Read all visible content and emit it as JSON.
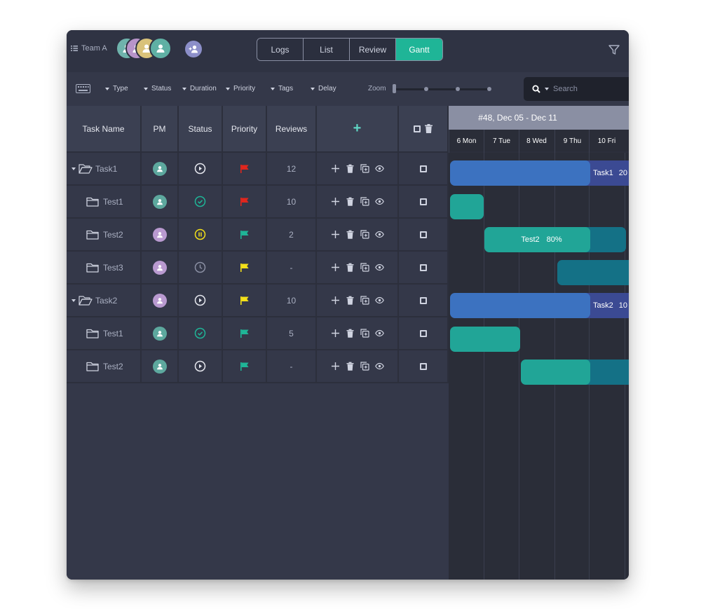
{
  "header": {
    "team_label": "Team A",
    "view_tabs": [
      "Logs",
      "List",
      "Review",
      "Gantt"
    ],
    "active_view": "Gantt",
    "colors": {
      "accent": "#1fb597",
      "background": "#343849",
      "topbar": "#2f3343"
    }
  },
  "filters": {
    "items": [
      "Type",
      "Status",
      "Duration",
      "Priority",
      "Tags",
      "Delay"
    ],
    "zoom_label": "Zoom",
    "search_placeholder": "Search"
  },
  "table": {
    "columns": [
      "Task Name",
      "PM",
      "Status",
      "Priority",
      "Reviews"
    ],
    "add_column_symbol": "+",
    "rows": [
      {
        "name": "Task1",
        "type": "task",
        "pm": "teal",
        "status": "in-progress",
        "priority": "red",
        "reviews": "12"
      },
      {
        "name": "Test1",
        "type": "test",
        "pm": "teal",
        "status": "done",
        "priority": "red",
        "reviews": "10"
      },
      {
        "name": "Test2",
        "type": "test",
        "pm": "purple",
        "status": "paused",
        "priority": "green",
        "reviews": "2"
      },
      {
        "name": "Test3",
        "type": "test",
        "pm": "purple",
        "status": "pending",
        "priority": "yellow",
        "reviews": "-"
      },
      {
        "name": "Task2",
        "type": "task",
        "pm": "purple",
        "status": "in-progress",
        "priority": "yellow",
        "reviews": "10"
      },
      {
        "name": "Test1",
        "type": "test",
        "pm": "teal",
        "status": "done",
        "priority": "green",
        "reviews": "5"
      },
      {
        "name": "Test2",
        "type": "test",
        "pm": "teal",
        "status": "in-progress",
        "priority": "green",
        "reviews": "-"
      }
    ]
  },
  "gantt": {
    "week_label": "#48, Dec 05 - Dec 11",
    "days": [
      "6 Mon",
      "7 Tue",
      "8 Wed",
      "9 Thu",
      "10 Fri"
    ],
    "bars": [
      {
        "label": "Task1",
        "percent": "20"
      },
      {
        "label": "",
        "percent": ""
      },
      {
        "label": "Test2",
        "percent": "80%"
      },
      {
        "label": "",
        "percent": ""
      },
      {
        "label": "Task2",
        "percent": "10"
      },
      {
        "label": "",
        "percent": ""
      },
      {
        "label": "",
        "percent": ""
      }
    ]
  }
}
